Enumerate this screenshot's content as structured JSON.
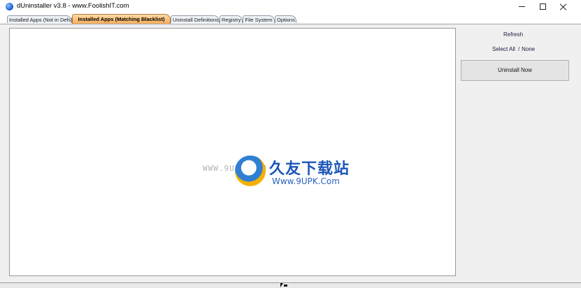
{
  "window": {
    "title": "dUninstaller v3.8   -  www.FoolishIT.com",
    "icon": "app-globe-icon"
  },
  "tabs": [
    {
      "label": "Installed Apps (Not in Defs)",
      "active": false
    },
    {
      "label": "Installed Apps (Matching Blacklist)",
      "active": true
    },
    {
      "label": "Uninstall Definitions",
      "active": false
    },
    {
      "label": "Registry",
      "active": false
    },
    {
      "label": "File System",
      "active": false
    },
    {
      "label": "Options",
      "active": false
    }
  ],
  "actions": {
    "refresh": "Refresh",
    "select_all": "Select All",
    "separator": "/",
    "none": "None",
    "uninstall_now": "Uninstall Now"
  },
  "watermark": {
    "left_text": "WWW.9UPK.COM",
    "cn_text": "久友下载站",
    "en_text": "Www.9UPK.Com"
  },
  "colors": {
    "active_tab": "#f6ad5c",
    "watermark_blue": "#1b56b8"
  }
}
